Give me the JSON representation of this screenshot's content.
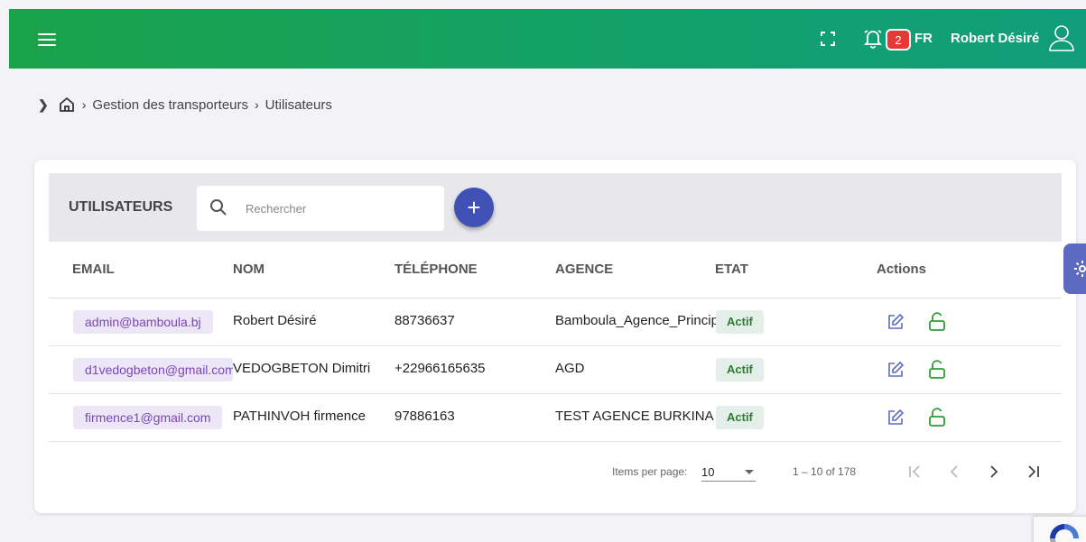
{
  "topbar": {
    "notification_count": "2",
    "language": "FR",
    "user_name": "Robert Désiré"
  },
  "breadcrumb": {
    "items": [
      "Gestion des transporteurs",
      "Utilisateurs"
    ]
  },
  "card": {
    "title": "UTILISATEURS",
    "search_placeholder": "Rechercher",
    "add_label": "+"
  },
  "table": {
    "columns": [
      "EMAIL",
      "NOM",
      "TÉLÉPHONE",
      "AGENCE",
      "ETAT",
      "Actions"
    ],
    "rows": [
      {
        "email": "admin@bamboula.bj",
        "nom": "Robert Désiré",
        "telephone": "88736637",
        "agence": "Bamboula_Agence_Principale",
        "etat": "Actif"
      },
      {
        "email": "d1vedogbeton@gmail.com",
        "nom": "VEDOGBETON Dimitri",
        "telephone": "+22966165635",
        "agence": "AGD",
        "etat": "Actif"
      },
      {
        "email": "firmence1@gmail.com",
        "nom": "PATHINVOH firmence",
        "telephone": "97886163",
        "agence": "TEST AGENCE BURKINA",
        "etat": "Actif"
      }
    ]
  },
  "paginator": {
    "items_per_page_label": "Items per page:",
    "items_per_page": "10",
    "range_label": "1 – 10 of 178"
  },
  "colors": {
    "topbar_start": "#1aa34a",
    "topbar_end": "#119d7a",
    "primary": "#3f51b5",
    "email_chip_bg": "#ece6f7",
    "email_chip_text": "#7a47b5",
    "status_active_bg": "#e3efe8",
    "status_active_text": "#2e7d32",
    "edit_icon": "#5c6bc0",
    "lock_icon": "#2e9e2e"
  },
  "icons": [
    "menu-icon",
    "fullscreen-icon",
    "bell-icon",
    "user-icon",
    "home-icon",
    "search-icon",
    "edit-icon",
    "unlock-icon",
    "first-page-icon",
    "prev-page-icon",
    "next-page-icon",
    "last-page-icon",
    "gear-icon"
  ]
}
